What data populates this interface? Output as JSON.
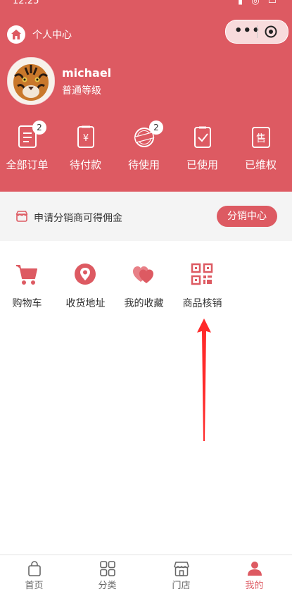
{
  "status_bar": {
    "time": "12:25"
  },
  "nav": {
    "title": "个人中心"
  },
  "user": {
    "name": "michael",
    "level": "普通等级"
  },
  "orders": [
    {
      "label": "全部订单",
      "badge": "2",
      "icon": "order-list-icon"
    },
    {
      "label": "待付款",
      "badge": "",
      "icon": "pending-payment-icon"
    },
    {
      "label": "待使用",
      "badge": "2",
      "icon": "to-use-icon"
    },
    {
      "label": "已使用",
      "badge": "",
      "icon": "used-icon"
    },
    {
      "label": "已维权",
      "badge": "",
      "icon": "after-sale-icon"
    }
  ],
  "promo": {
    "text": "申请分销商可得佣金",
    "button": "分销中心"
  },
  "tools": [
    {
      "label": "购物车",
      "icon": "cart-icon"
    },
    {
      "label": "收货地址",
      "icon": "location-icon"
    },
    {
      "label": "我的收藏",
      "icon": "hearts-icon"
    },
    {
      "label": "商品核销",
      "icon": "qr-code-icon"
    }
  ],
  "tabs": [
    {
      "label": "首页",
      "icon": "bag-icon"
    },
    {
      "label": "分类",
      "icon": "grid-icon"
    },
    {
      "label": "门店",
      "icon": "store-icon"
    },
    {
      "label": "我的",
      "icon": "user-icon"
    }
  ],
  "colors": {
    "brand": "#dd5a62",
    "annotation_arrow": "#ff2a2a"
  }
}
